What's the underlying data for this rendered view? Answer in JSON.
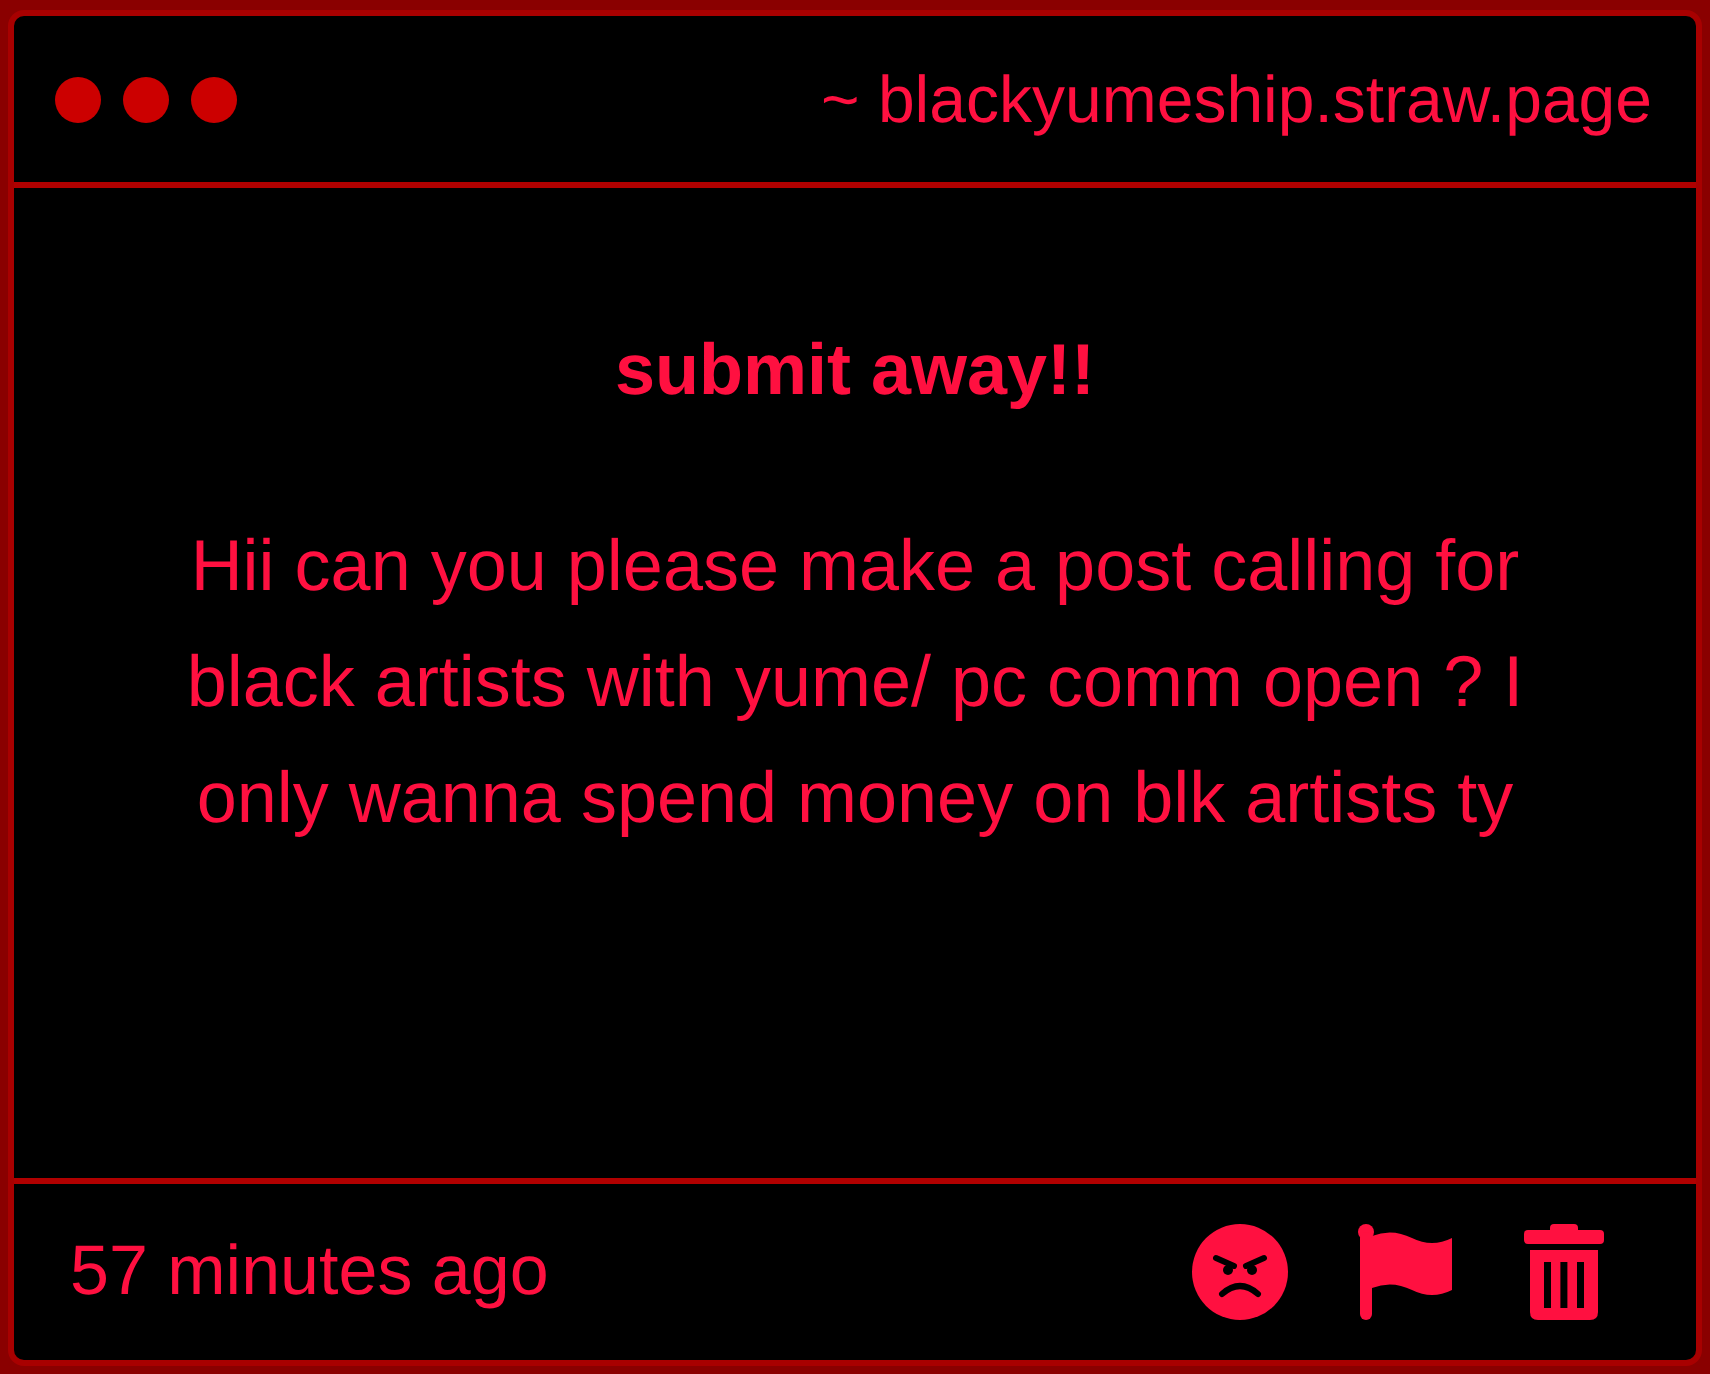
{
  "header": {
    "url": "~ blackyumeship.straw.page"
  },
  "post": {
    "title": "submit away!!",
    "message": "Hii can you please make a post calling for black artists with yume/ pc comm open ? I only wanna spend money on blk artists ty"
  },
  "footer": {
    "time": "57 minutes ago"
  }
}
